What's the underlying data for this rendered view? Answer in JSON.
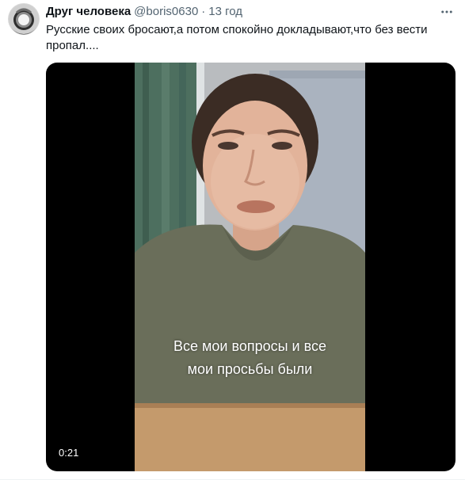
{
  "tweet": {
    "author": {
      "display_name": "Друг человека",
      "handle": "@boris0630",
      "separator": "·",
      "time": "13 год"
    },
    "text": "Русские своих бросают,а потом спокойно докладывают,что без вести пропал....",
    "more_icon": "more-horizontal-icon",
    "video": {
      "caption_line_1": "Все мои вопросы и все",
      "caption_line_2": "мои просьбы были",
      "duration": "0:21"
    }
  }
}
